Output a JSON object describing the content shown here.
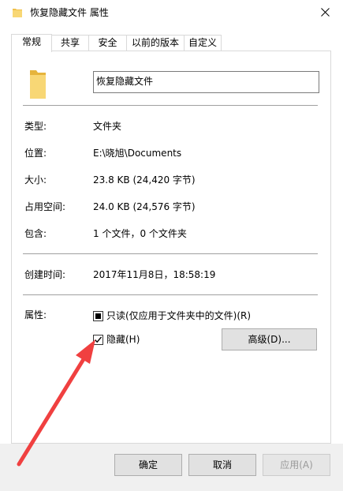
{
  "window": {
    "title": "恢复隐藏文件 属性"
  },
  "tabs": [
    {
      "label": "常规"
    },
    {
      "label": "共享"
    },
    {
      "label": "安全"
    },
    {
      "label": "以前的版本"
    },
    {
      "label": "自定义"
    }
  ],
  "general": {
    "name": "恢复隐藏文件",
    "rows": [
      {
        "label": "类型:",
        "value": "文件夹"
      },
      {
        "label": "位置:",
        "value": "E:\\晓旭\\Documents"
      },
      {
        "label": "大小:",
        "value": "23.8 KB (24,420 字节)"
      },
      {
        "label": "占用空间:",
        "value": "24.0 KB (24,576 字节)"
      },
      {
        "label": "包含:",
        "value": "1 个文件，0 个文件夹"
      }
    ],
    "created": {
      "label": "创建时间:",
      "value": "2017年11月8日，18:58:19"
    },
    "attributes": {
      "label": "属性:",
      "readonly_label": "只读(仅应用于文件夹中的文件)(R)",
      "hidden_label": "隐藏(H)",
      "advanced_label": "高级(D)..."
    }
  },
  "buttons": {
    "ok": "确定",
    "cancel": "取消",
    "apply": "应用(A)"
  },
  "colors": {
    "folder": "#f0c04a",
    "annotation_arrow": "#f04040"
  }
}
